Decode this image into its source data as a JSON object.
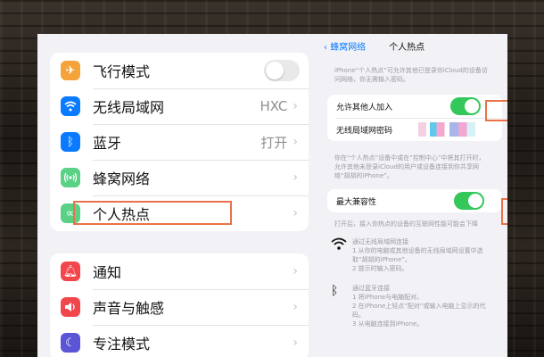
{
  "left": {
    "group1": [
      {
        "label": "飞行模式",
        "icon": "airplane-icon",
        "color": "#f4a33a",
        "control": "toggle-off"
      },
      {
        "label": "无线局域网",
        "icon": "wifi-icon",
        "color": "#0a7aff",
        "value": "HXC"
      },
      {
        "label": "蓝牙",
        "icon": "bluetooth-icon",
        "color": "#0a7aff",
        "value": "打开"
      },
      {
        "label": "蜂窝网络",
        "icon": "antenna-icon",
        "color": "#5ad184"
      },
      {
        "label": "个人热点",
        "icon": "link-icon",
        "color": "#5ad184"
      }
    ],
    "group2": [
      {
        "label": "通知",
        "icon": "bell-icon",
        "color": "#f2464d"
      },
      {
        "label": "声音与触感",
        "icon": "speaker-icon",
        "color": "#f2464d"
      },
      {
        "label": "专注模式",
        "icon": "moon-icon",
        "color": "#5a55d6"
      }
    ]
  },
  "right": {
    "back_label": "蜂窝网络",
    "title": "个人热点",
    "intro": "iPhone“个人热点”可允许其他已登录你iCloud的设备访问网络，你无需输入密码。",
    "allow_label": "允许其他人加入",
    "password_label": "无线局域网密码",
    "desc": "你在“个人热点”设备中或在“控制中心”中将其打开时，允许其他未登录iCloud的用户或设备连接到你共享网络“胡胡的iPhone”。",
    "compat_label": "最大兼容性",
    "compat_desc": "打开后，接入你热点的设备的互联网性能可能会下降",
    "wifi_steps_title": "通过无线局域网连接",
    "wifi_steps": [
      "1 从你的电脑或其他设备的无线局域网设置中选取“胡胡的iPhone”。",
      "2 提示时输入密码。"
    ],
    "bt_steps_title": "通过蓝牙连接",
    "bt_steps": [
      "1 将iPhone与电脑配对。",
      "2 在iPhone上轻点“配对”或输入电脑上显示的代码。",
      "3 从电脑连接到iPhone。"
    ]
  },
  "colors": {
    "accent": "#0a7aff",
    "toggle_on": "#34c759",
    "highlight": "#e9724a"
  }
}
